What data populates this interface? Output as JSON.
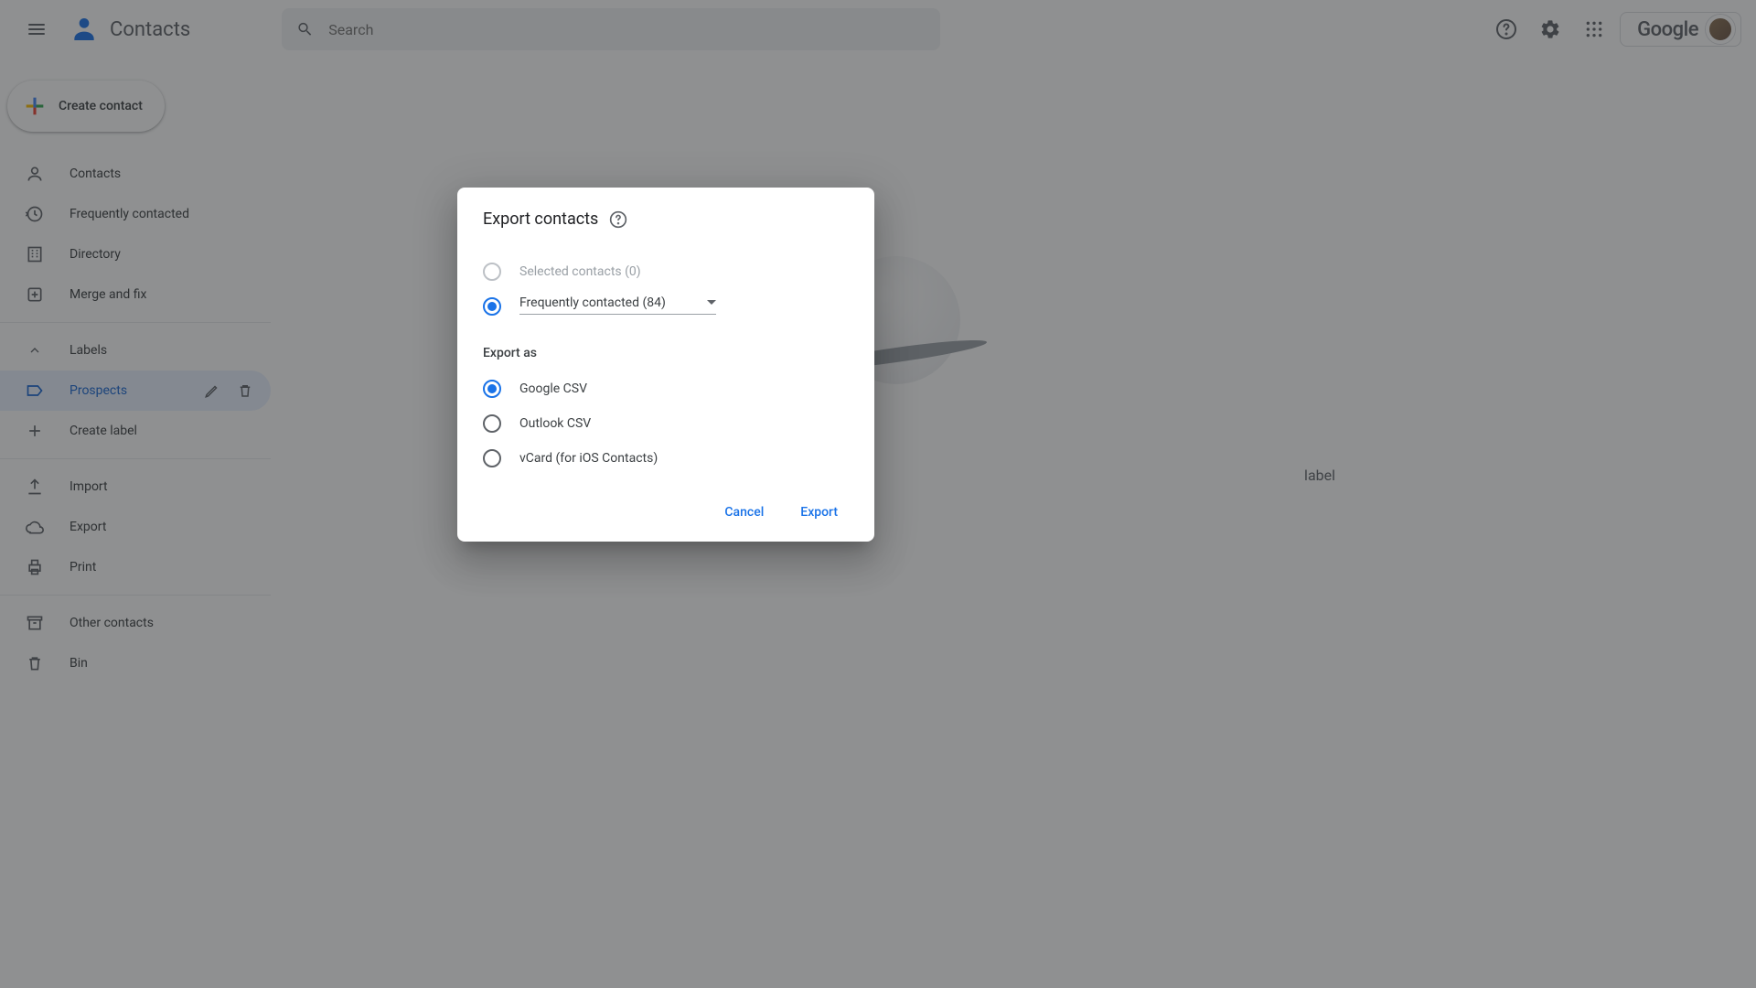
{
  "header": {
    "app_name": "Contacts",
    "search_placeholder": "Search",
    "google_text": "Google"
  },
  "sidebar": {
    "create_label": "Create contact",
    "nav1": [
      {
        "label": "Contacts"
      },
      {
        "label": "Frequently contacted"
      },
      {
        "label": "Directory"
      },
      {
        "label": "Merge and fix"
      }
    ],
    "labels_header": "Labels",
    "labels": [
      {
        "label": "Prospects"
      }
    ],
    "create_label_label": "Create label",
    "nav2": [
      {
        "label": "Import"
      },
      {
        "label": "Export"
      },
      {
        "label": "Print"
      }
    ],
    "nav3": [
      {
        "label": "Other contacts"
      },
      {
        "label": "Bin"
      }
    ]
  },
  "main": {
    "hint_suffix": "label"
  },
  "dialog": {
    "title": "Export contacts",
    "selection": {
      "selected_label": "Selected contacts (0)",
      "dropdown_value": "Frequently contacted (84)"
    },
    "export_as_label": "Export as",
    "formats": [
      {
        "label": "Google CSV"
      },
      {
        "label": "Outlook CSV"
      },
      {
        "label": "vCard (for iOS Contacts)"
      }
    ],
    "cancel": "Cancel",
    "export": "Export"
  }
}
